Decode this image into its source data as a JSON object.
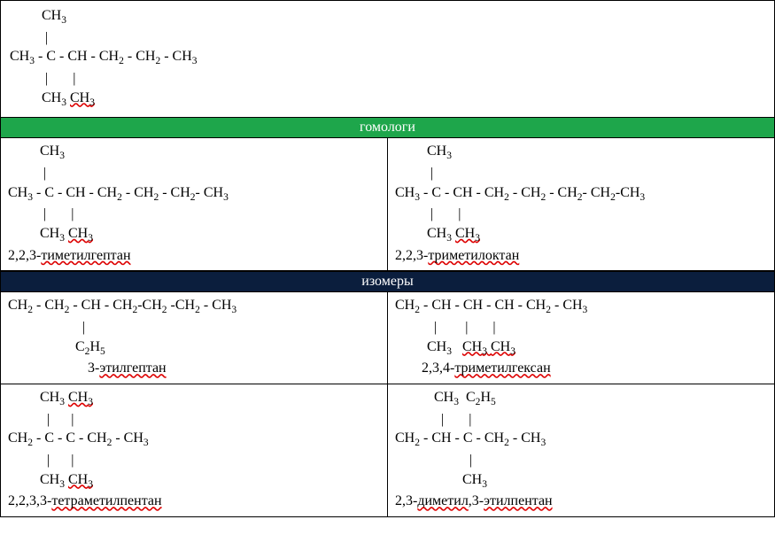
{
  "top_formula": {
    "l1": "         CH₃",
    "l2": "          |",
    "l3": "CH₃ - C - CH - CH₂ - CH₂ - CH₃",
    "l4": "          |       |",
    "l5a": "         CH₃ ",
    "l5b": "CH₃"
  },
  "headers": {
    "homologs": "гомологи",
    "isomers": "изомеры"
  },
  "homologs": [
    {
      "l1": "         CH₃",
      "l2": "          |",
      "l3": "CH₃ - C - CH - CH₂ - CH₂ - CH₂- CH₃",
      "l4": "          |       |",
      "l5a": "         CH₃ ",
      "l5b": "CH₃",
      "name_pre": "2,2,3-",
      "name_spell": "тиметилгептан"
    },
    {
      "l1": "         CH₃",
      "l2": "          |",
      "l3": "CH₃ - C - CH - CH₂ - CH₂ - CH₂- CH₂-CH₃",
      "l4": "          |       |",
      "l5a": "         CH₃ ",
      "l5b": "CH₃",
      "name_pre": "2,2,3-",
      "name_spell": "триметилоктан"
    }
  ],
  "isomers": [
    {
      "l1": "CH₂ - CH₂ - CH - CH₂-CH₂ -CH₂ - CH₃",
      "l2": "                     |",
      "l3": "                   C₂H₅",
      "name_pre": "3-",
      "name_spell": "этилгептан",
      "name_center": true
    },
    {
      "l1": "CH₂ - CH - CH - CH - CH₂ - CH₃",
      "l2": "           |        |       |",
      "l3a": "         CH₃   ",
      "l3b": "CH₃ ",
      "l3c": "CH₃",
      "name_pre": "2,3,4-",
      "name_spell": "триметилгексан",
      "name_center2": true
    },
    {
      "l0a": "         CH₃ ",
      "l0b": "CH₃",
      "l1": "           |      |",
      "l2": "CH₂ - C - C - CH₂ - CH₃",
      "l3": "           |      |",
      "l4a": "         CH₃ ",
      "l4b": "CH₃",
      "name_pre": "2,2,3,3-",
      "name_spell": "тетраметилпентан"
    },
    {
      "l0": "           CH₃  C₂H₅",
      "l1": "             |       |",
      "l2": "CH₂ - CH - C - CH₂ - CH₃",
      "l3": "                     |",
      "l4": "                   CH₃",
      "name_pre": "2,3-",
      "name_mid": "диметил",
      "name_post": ",3-",
      "name_spell": "этилпентан"
    }
  ]
}
